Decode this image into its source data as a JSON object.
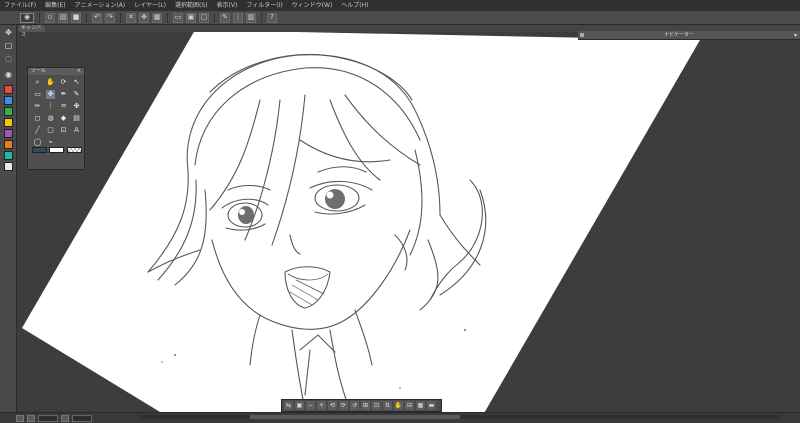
{
  "menu": {
    "items": [
      "ファイル(F)",
      "編集(E)",
      "アニメーション(A)",
      "レイヤー(L)",
      "選択範囲(S)",
      "表示(V)",
      "フィルター(I)",
      "ウィンドウ(W)",
      "ヘルプ(H)"
    ]
  },
  "toolbar": {
    "buttons": [
      {
        "name": "eye-icon",
        "glyph": "◉"
      },
      {
        "name": "new-file-icon",
        "glyph": "▫"
      },
      {
        "name": "open-icon",
        "glyph": "▤"
      },
      {
        "name": "save-icon",
        "glyph": "■"
      },
      {
        "name": "undo-icon",
        "glyph": "↶"
      },
      {
        "name": "redo-icon",
        "glyph": "↷"
      },
      {
        "name": "clear-icon",
        "glyph": "✕"
      },
      {
        "name": "transform-icon",
        "glyph": "✥"
      },
      {
        "name": "grid-icon",
        "glyph": "▦"
      },
      {
        "name": "select-icon",
        "glyph": "▭"
      },
      {
        "name": "fill-icon",
        "glyph": "▣"
      },
      {
        "name": "deselect-icon",
        "glyph": "▢"
      },
      {
        "name": "pen-icon",
        "glyph": "✎"
      },
      {
        "name": "brush-icon",
        "glyph": "ᛁ"
      },
      {
        "name": "layer-icon",
        "glyph": "▥"
      },
      {
        "name": "help-icon",
        "glyph": "?"
      }
    ]
  },
  "canvas": {
    "tab_label": "キャンバス",
    "background": "#3d3d3d",
    "paper_color": "#ffffff"
  },
  "right_panel": {
    "title": "ナビゲーター"
  },
  "tool_palette": {
    "title": "ツール",
    "tools": [
      {
        "name": "zoom-icon",
        "glyph": "⌕"
      },
      {
        "name": "hand-icon",
        "glyph": "✋"
      },
      {
        "name": "rotate-icon",
        "glyph": "⟳"
      },
      {
        "name": "operation-icon",
        "glyph": "↖"
      },
      {
        "name": "rect-select-icon",
        "glyph": "▭"
      },
      {
        "name": "move-icon",
        "glyph": "✥"
      },
      {
        "name": "dropper-icon",
        "glyph": "✒"
      },
      {
        "name": "pen-tool-icon",
        "glyph": "✎"
      },
      {
        "name": "pencil-icon",
        "glyph": "✏"
      },
      {
        "name": "brush-tool-icon",
        "glyph": "ᛁ"
      },
      {
        "name": "airbrush-icon",
        "glyph": "♒"
      },
      {
        "name": "decoration-icon",
        "glyph": "✤"
      },
      {
        "name": "eraser-icon",
        "glyph": "◻"
      },
      {
        "name": "blend-icon",
        "glyph": "◍"
      },
      {
        "name": "fill-tool-icon",
        "glyph": "◆"
      },
      {
        "name": "gradient-icon",
        "glyph": "▤"
      },
      {
        "name": "figure-icon",
        "glyph": "╱"
      },
      {
        "name": "frame-icon",
        "glyph": "▢"
      },
      {
        "name": "ruler-icon",
        "glyph": "⊡"
      },
      {
        "name": "text-icon",
        "glyph": "A"
      },
      {
        "name": "balloon-icon",
        "glyph": "◯"
      },
      {
        "name": "correct-line-icon",
        "glyph": "⌁"
      }
    ],
    "main_color": "#2e4b5a",
    "sub_color": "#ffffff"
  },
  "strip": {
    "items": [
      {
        "name": "move-layer-icon",
        "glyph": "✥"
      },
      {
        "name": "select-tool-icon",
        "glyph": "▢"
      },
      {
        "name": "lasso-icon",
        "glyph": "◌"
      },
      {
        "name": "color-wheel-icon",
        "glyph": "◉"
      }
    ],
    "swatches": [
      "#e84c3d",
      "#3b8fe0",
      "#2fb34a",
      "#f1c40f",
      "#9b59b6",
      "#e67e22",
      "#1abc9c",
      "#e8e8e8"
    ]
  },
  "navigator": {
    "buttons": [
      {
        "name": "flip-h-icon",
        "glyph": "⇆"
      },
      {
        "name": "zoom-fit-icon",
        "glyph": "▣"
      },
      {
        "name": "zoom-out-icon",
        "glyph": "−"
      },
      {
        "name": "zoom-in-icon",
        "glyph": "+"
      },
      {
        "name": "rotate-left-icon",
        "glyph": "⟲"
      },
      {
        "name": "rotate-right-icon",
        "glyph": "⟳"
      },
      {
        "name": "reset-rotate-icon",
        "glyph": "↺"
      },
      {
        "name": "fit-window-icon",
        "glyph": "⊞"
      },
      {
        "name": "actual-size-icon",
        "glyph": "⊡"
      },
      {
        "name": "flip-v-icon",
        "glyph": "⇅"
      },
      {
        "name": "hand-nav-icon",
        "glyph": "✋"
      },
      {
        "name": "ruler-nav-icon",
        "glyph": "⊟"
      },
      {
        "name": "grid-nav-icon",
        "glyph": "▦"
      },
      {
        "name": "menu-nav-icon",
        "glyph": "▬"
      }
    ]
  }
}
